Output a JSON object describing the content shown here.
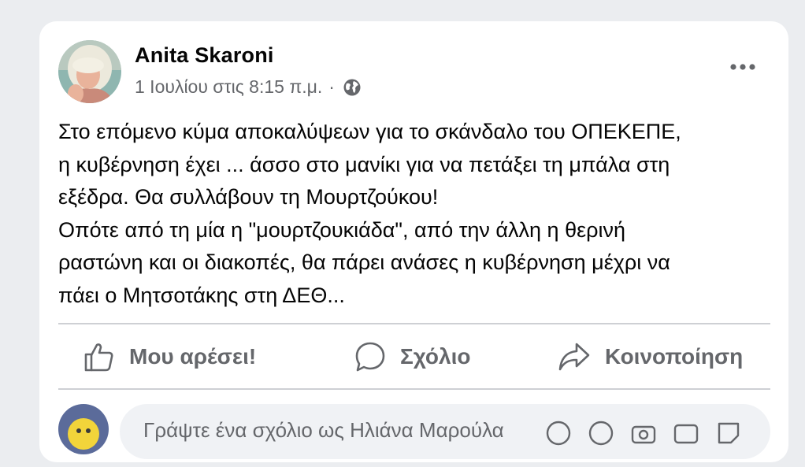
{
  "post": {
    "author": "Anita Skaroni",
    "timestamp": "1 Ιουλίου στις 8:15 π.μ.",
    "separator": "·",
    "audience_icon": "globe-icon",
    "more_icon": "ellipsis-icon",
    "text_lines": [
      "Στο επόμενο κύμα αποκαλύψεων για το σκάνδαλο του ΟΠΕΚΕΠΕ,",
      "η κυβέρνηση έχει ... άσσο στο μανίκι για να πετάξει τη μπάλα στη",
      "εξέδρα. Θα συλλάβουν τη Μουρτζούκου!",
      "Οπότε από τη μία η \"μουρτζουκιάδα\", από την άλλη η θερινή",
      "ραστώνη και οι διακοπές, θα πάρει ανάσες η κυβέρνηση μέχρι να",
      "πάει ο Μητσοτάκης στη ΔΕΘ..."
    ]
  },
  "actions": {
    "like_label": "Μου αρέσει!",
    "comment_label": "Σχόλιο",
    "share_label": "Κοινοποίηση"
  },
  "comment": {
    "placeholder": "Γράψτε ένα σχόλιο ως Ηλιάνα Μαρούλα"
  }
}
